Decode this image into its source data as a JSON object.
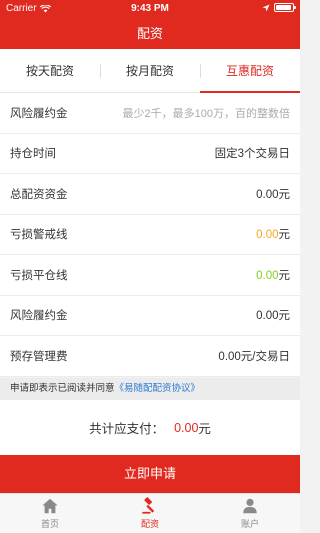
{
  "status_bar": {
    "carrier": "Carrier",
    "time": "9:43 PM"
  },
  "nav": {
    "title": "配资"
  },
  "tabs": [
    {
      "label": "按天配资",
      "active": false
    },
    {
      "label": "按月配资",
      "active": false
    },
    {
      "label": "互惠配资",
      "active": true
    }
  ],
  "form": {
    "deposit": {
      "label": "风险履约金",
      "placeholder": "最少2千，最多100万，百的整数倍"
    },
    "duration": {
      "label": "持仓时间",
      "value": "固定3个交易日"
    },
    "total_funds": {
      "label": "总配资资金",
      "value": "0.00元"
    },
    "warning_line": {
      "label": "亏损警戒线",
      "amount": "0.00",
      "unit": "元",
      "color": "#f5a623"
    },
    "liquidation_line": {
      "label": "亏损平仓线",
      "amount": "0.00",
      "unit": "元",
      "color": "#7ed321"
    },
    "risk_deposit": {
      "label": "风险履约金",
      "value": "0.00元"
    },
    "management_fee": {
      "label": "预存管理费",
      "value": "0.00元/交易日"
    }
  },
  "agreement": {
    "text": "申请即表示已阅读并同意",
    "link": "《易随配配资协议》"
  },
  "total": {
    "label": "共计应支付：",
    "amount": "0.00",
    "unit": "元"
  },
  "submit": {
    "label": "立即申请"
  },
  "bottom_tabs": [
    {
      "label": "首页",
      "icon": "home-icon",
      "active": false
    },
    {
      "label": "配资",
      "icon": "gavel-icon",
      "active": true
    },
    {
      "label": "账户",
      "icon": "user-icon",
      "active": false
    }
  ],
  "colors": {
    "brand": "#e02a1f",
    "link": "#2a7ad6"
  }
}
